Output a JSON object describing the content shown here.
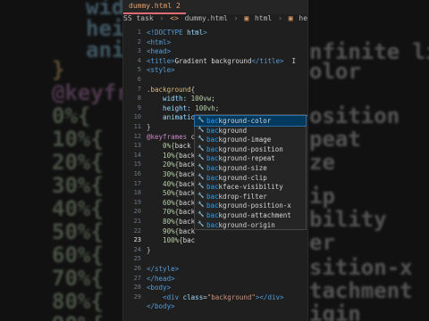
{
  "background": {
    "left_lines": [
      {
        "text": "widt",
        "color": "#9cdcfe"
      },
      {
        "text": "heig",
        "color": "#9cdcfe"
      },
      {
        "text": "anim",
        "color": "#9cdcfe"
      },
      {
        "text": "}",
        "color": "#e5c07b"
      },
      {
        "text": "@keyframes",
        "color": "#c586c0"
      },
      {
        "text": "0%{",
        "color": "#b5cea8"
      },
      {
        "text": "10%{",
        "color": "#b5cea8"
      },
      {
        "text": "20%{",
        "color": "#b5cea8"
      },
      {
        "text": "30%{",
        "color": "#b5cea8"
      },
      {
        "text": "40%{",
        "color": "#b5cea8"
      },
      {
        "text": "50%{",
        "color": "#b5cea8"
      },
      {
        "text": "60%{",
        "color": "#b5cea8"
      },
      {
        "text": "70%{",
        "color": "#b5cea8"
      },
      {
        "text": "80%{",
        "color": "#b5cea8"
      },
      {
        "text": "90%{",
        "color": "#b5cea8"
      }
    ],
    "right_lines": [
      {
        "text": "nfinite linear;",
        "color": "#d4d4d4"
      },
      {
        "text": "olor",
        "color": "#d4d4d4"
      },
      {
        "text": "osition",
        "color": "#d4d4d4"
      },
      {
        "text": "peat",
        "color": "#d4d4d4"
      },
      {
        "text": "ze",
        "color": "#d4d4d4"
      },
      {
        "text": "ip",
        "color": "#d4d4d4"
      },
      {
        "text": "bility",
        "color": "#d4d4d4"
      },
      {
        "text": "er",
        "color": "#d4d4d4"
      },
      {
        "text": "sition-x",
        "color": "#d4d4d4"
      },
      {
        "text": "tachment",
        "color": "#d4d4d4"
      },
      {
        "text": "igin",
        "color": "#d4d4d4"
      }
    ]
  },
  "editor": {
    "tab_label": "dummy.html",
    "tab_badge": "2",
    "breadcrumbs": [
      "SS task",
      "dummy.html",
      "html",
      "head",
      "style"
    ],
    "line_numbers": [
      "1",
      "2",
      "3",
      "4",
      "5",
      "6",
      "7",
      "8",
      "9",
      "10",
      "11",
      "12",
      "13",
      "14",
      "15",
      "16",
      "17",
      "18",
      "19",
      "20",
      "21",
      "22",
      "23",
      "24",
      "25",
      "26",
      "27",
      "28",
      "29"
    ],
    "current_line": "23",
    "code_lines": [
      [
        {
          "t": "<!DOCTYPE ",
          "c": "tag"
        },
        {
          "t": "html",
          "c": "attr"
        },
        {
          "t": ">",
          "c": "tag"
        }
      ],
      [
        {
          "t": "<html>",
          "c": "tag"
        }
      ],
      [
        {
          "t": "<head>",
          "c": "tag"
        }
      ],
      [
        {
          "t": "<title>",
          "c": "tag"
        },
        {
          "t": "Gradient background",
          "c": "txt"
        },
        {
          "t": "</title>",
          "c": "tag"
        },
        {
          "t": "  I",
          "c": "cursor-i"
        }
      ],
      [
        {
          "t": "<style>",
          "c": "tag"
        }
      ],
      [
        {
          "t": "",
          "c": "txt"
        }
      ],
      [
        {
          "t": ".background",
          "c": "sel"
        },
        {
          "t": "{",
          "c": "fold"
        }
      ],
      [
        {
          "t": "    width: ",
          "c": "prop"
        },
        {
          "t": "100vw",
          "c": "num"
        },
        {
          "t": ";",
          "c": "txt"
        }
      ],
      [
        {
          "t": "    height: ",
          "c": "prop"
        },
        {
          "t": "100vh",
          "c": "num"
        },
        {
          "t": ";",
          "c": "txt"
        }
      ],
      [
        {
          "t": "    animation: ",
          "c": "prop"
        },
        {
          "t": "change 3s infinite linear;",
          "c": "txt"
        }
      ],
      [
        {
          "t": "}",
          "c": "fold"
        }
      ],
      [
        {
          "t": "@keyframes ",
          "c": "kw"
        },
        {
          "t": "c",
          "c": "txt"
        }
      ],
      [
        {
          "t": "    0%{",
          "c": "num"
        },
        {
          "t": "back",
          "c": "txt"
        }
      ],
      [
        {
          "t": "    10%{",
          "c": "num"
        },
        {
          "t": "back",
          "c": "txt"
        }
      ],
      [
        {
          "t": "    20%{",
          "c": "num"
        },
        {
          "t": "back",
          "c": "txt"
        }
      ],
      [
        {
          "t": "    30%{",
          "c": "num"
        },
        {
          "t": "back",
          "c": "txt"
        }
      ],
      [
        {
          "t": "    40%{",
          "c": "num"
        },
        {
          "t": "back",
          "c": "txt"
        }
      ],
      [
        {
          "t": "    50%{",
          "c": "num"
        },
        {
          "t": "back",
          "c": "txt"
        }
      ],
      [
        {
          "t": "    60%{",
          "c": "num"
        },
        {
          "t": "back",
          "c": "txt"
        }
      ],
      [
        {
          "t": "    70%{",
          "c": "num"
        },
        {
          "t": "back",
          "c": "txt"
        }
      ],
      [
        {
          "t": "    80%{",
          "c": "num"
        },
        {
          "t": "back",
          "c": "txt"
        }
      ],
      [
        {
          "t": "    90%{",
          "c": "num"
        },
        {
          "t": "back",
          "c": "txt"
        }
      ],
      [
        {
          "t": "    100%{",
          "c": "num"
        },
        {
          "t": "bac",
          "c": "txt"
        }
      ],
      [
        {
          "t": "}",
          "c": "fold"
        }
      ],
      [
        {
          "t": "",
          "c": "txt"
        }
      ],
      [
        {
          "t": "</style>",
          "c": "tag"
        }
      ],
      [
        {
          "t": "</head>",
          "c": "tag"
        }
      ],
      [
        {
          "t": "<body>",
          "c": "tag"
        }
      ],
      [
        {
          "t": "    <div ",
          "c": "tag"
        },
        {
          "t": "class",
          "c": "attr"
        },
        {
          "t": "=",
          "c": "txt"
        },
        {
          "t": "\"background\"",
          "c": "str"
        },
        {
          "t": "></div>",
          "c": "tag"
        }
      ],
      [
        {
          "t": "</body>",
          "c": "tag"
        }
      ]
    ]
  },
  "suggestions": {
    "prefix": "bac",
    "items": [
      "background-color",
      "background",
      "background-image",
      "background-position",
      "background-repeat",
      "background-size",
      "background-clip",
      "backface-visibility",
      "backdrop-filter",
      "background-position-x",
      "background-attachment",
      "background-origin"
    ],
    "active_index": 0
  },
  "colors": {
    "editor_bg": "#1f1f1f",
    "suggest_active": "#04395e",
    "match": "#18a3ff",
    "tag": "#569cd6"
  }
}
